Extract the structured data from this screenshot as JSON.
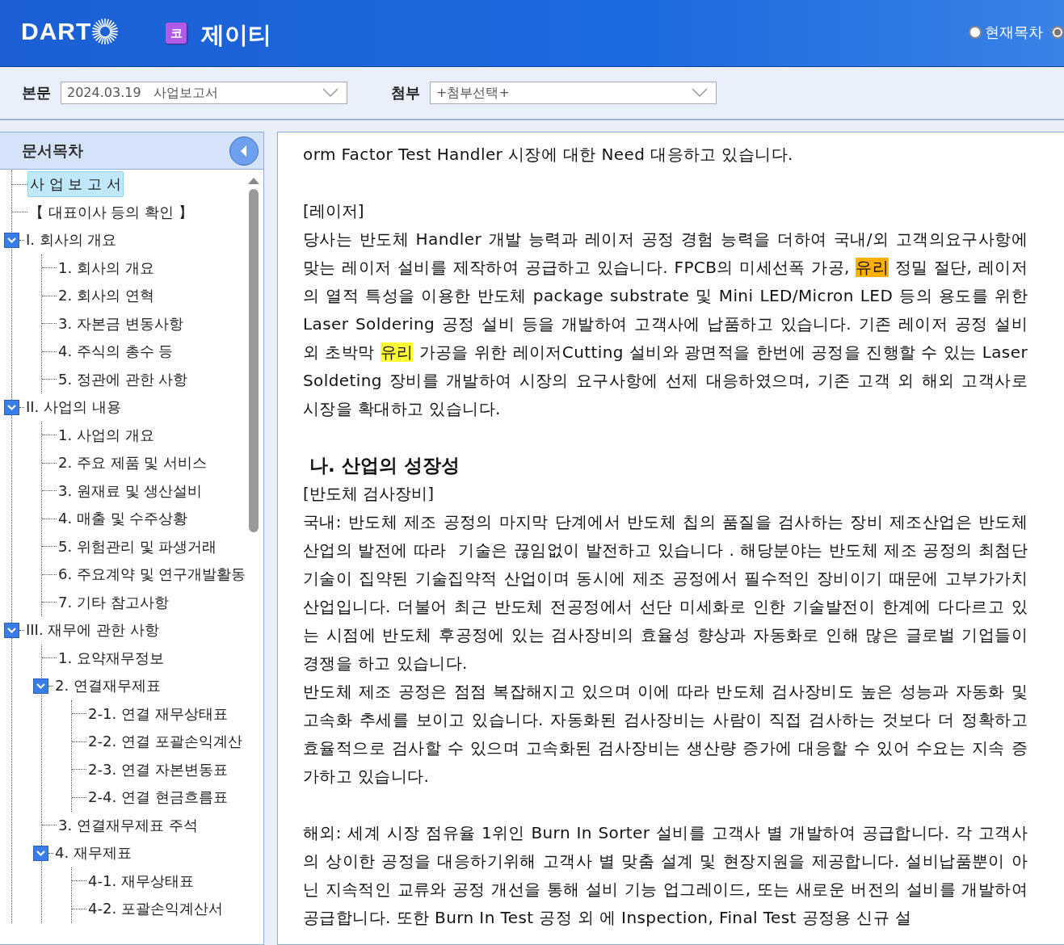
{
  "header": {
    "logo": "DART",
    "market_badge": "코",
    "company": "제이티",
    "radio_options": [
      {
        "label": "현재목차",
        "selected": false
      },
      {
        "selected": true
      }
    ]
  },
  "toolbar": {
    "fields": [
      {
        "label": "본문",
        "value": "2024.03.19   사업보고서"
      },
      {
        "label": "첨부",
        "value": "+첨부선택+"
      }
    ]
  },
  "toc": {
    "title": "문서목차",
    "items": [
      {
        "label": "사 업 보 고 서",
        "selected": true
      },
      {
        "label": "【 대표이사 등의 확인 】",
        "selected": false
      },
      {
        "label": "I. 회사의 개요",
        "selected": false,
        "expanded": true,
        "children": [
          {
            "label": "1. 회사의 개요",
            "selected": false
          },
          {
            "label": "2. 회사의 연혁",
            "selected": false
          },
          {
            "label": "3. 자본금 변동사항",
            "selected": false
          },
          {
            "label": "4. 주식의 총수 등",
            "selected": false
          },
          {
            "label": "5. 정관에 관한 사항",
            "selected": false
          }
        ]
      },
      {
        "label": "II. 사업의 내용",
        "selected": false,
        "expanded": true,
        "children": [
          {
            "label": "1. 사업의 개요",
            "selected": false
          },
          {
            "label": "2. 주요 제품 및 서비스",
            "selected": false
          },
          {
            "label": "3. 원재료 및 생산설비",
            "selected": false
          },
          {
            "label": "4. 매출 및 수주상황",
            "selected": false
          },
          {
            "label": "5. 위험관리 및 파생거래",
            "selected": false
          },
          {
            "label": "6. 주요계약 및 연구개발활동",
            "selected": false
          },
          {
            "label": "7. 기타 참고사항",
            "selected": false
          }
        ]
      },
      {
        "label": "III. 재무에 관한 사항",
        "selected": false,
        "expanded": true,
        "children": [
          {
            "label": "1. 요약재무정보",
            "selected": false
          },
          {
            "label": "2. 연결재무제표",
            "selected": false,
            "expanded": true,
            "children": [
              {
                "label": "2-1. 연결 재무상태표",
                "selected": false
              },
              {
                "label": "2-2. 연결 포괄손익계산",
                "selected": false
              },
              {
                "label": "2-3. 연결 자본변동표",
                "selected": false
              },
              {
                "label": "2-4. 연결 현금흐름표",
                "selected": false
              }
            ]
          },
          {
            "label": "3. 연결재무제표 주석",
            "selected": false
          },
          {
            "label": "4. 재무제표",
            "selected": false,
            "expanded": true,
            "children": [
              {
                "label": "4-1. 재무상태표",
                "selected": false
              },
              {
                "label": "4-2. 포괄손익계산서",
                "selected": false
              }
            ]
          }
        ]
      }
    ]
  },
  "document": {
    "sections": [
      [
        {
          "kind": "paragraph",
          "text": "orm Factor Test Handler 시장에 대한 Need 대응하고 있습니다."
        }
      ],
      [
        {
          "kind": "label",
          "text": "[레이저]"
        },
        {
          "kind": "paragraph",
          "segments": [
            {
              "text": "당사는 반도체 Handler 개발 능력과 레이저 공정 경험 능력을 더하여 국내/외 고객의요구사항에 맞는 레이저 설비를 제작하여 공급하고 있습니다. FPCB의 미세선폭 가공, "
            },
            {
              "text": "유리",
              "color": "#ffb000"
            },
            {
              "text": " 정밀 절단, 레이저의 열적 특성을 이용한 반도체 package substrate 및 Mini LED/Micron LED 등의 용도를 위한 Laser Soldering 공정 설비 등을 개발하여 고객사에 납품하고 있습니다. 기존 레이저 공정 설비 외 초박막 "
            },
            {
              "text": "유리",
              "color": "#ffff33"
            },
            {
              "text": " 가공을 위한 레이저Cutting 설비와 광면적을 한번에 공정을 진행할 수 있는 Laser Soldeting 장비를 개발하여 시장의 요구사항에 선제 대응하였으며, 기존 고객 외 해외 고객사로 시장을 확대하고 있습니다."
            }
          ]
        }
      ],
      [
        {
          "kind": "heading",
          "text": "나. 산업의 성장성"
        },
        {
          "kind": "label",
          "text": "[반도체 검사장비]"
        },
        {
          "kind": "paragraph",
          "text": "국내: 반도체 제조 공정의 마지막 단계에서 반도체 칩의 품질을 검사하는 장비 제조산업은 반도체 산업의 발전에 따라  기술은 끊임없이 발전하고 있습니다 . 해당분야는 반도체 제조 공정의 최첨단 기술이 집약된 기술집약적 산업이며 동시에 제조 공정에서 필수적인 장비이기 때문에 고부가가치 산업입니다. 더불어 최근 반도체 전공정에서 선단 미세화로 인한 기술발전이 한계에 다다르고 있는 시점에 반도체 후공정에 있는 검사장비의 효율성 향상과 자동화로 인해 많은 글로벌 기업들이 경쟁을 하고 있습니다."
        },
        {
          "kind": "paragraph",
          "text": "반도체 제조 공정은 점점 복잡해지고 있으며 이에 따라 반도체 검사장비도 높은 성능과 자동화 및 고속화 추세를 보이고 있습니다. 자동화된 검사장비는 사람이 직접 검사하는 것보다 더 정확하고 효율적으로 검사할 수 있으며 고속화된 검사장비는 생산량 증가에 대응할 수 있어 수요는 지속 증가하고 있습니다."
        }
      ],
      [
        {
          "kind": "paragraph",
          "text": "해외: 세계 시장 점유율 1위인 Burn In Sorter 설비를 고객사 별 개발하여 공급합니다. 각 고객사의 상이한 공정을 대응하기위해 고객사 별 맞춤 설계 및 현장지원을 제공합니다. 설비납품뿐이 아닌 지속적인 교류와 공정 개선을 통해 설비 기능 업그레이드, 또는 새로운 버전의 설비를 개발하여 공급합니다. 또한 Burn In Test 공정 외 에 Inspection, Final Test 공정용 신규 설"
        }
      ]
    ]
  }
}
